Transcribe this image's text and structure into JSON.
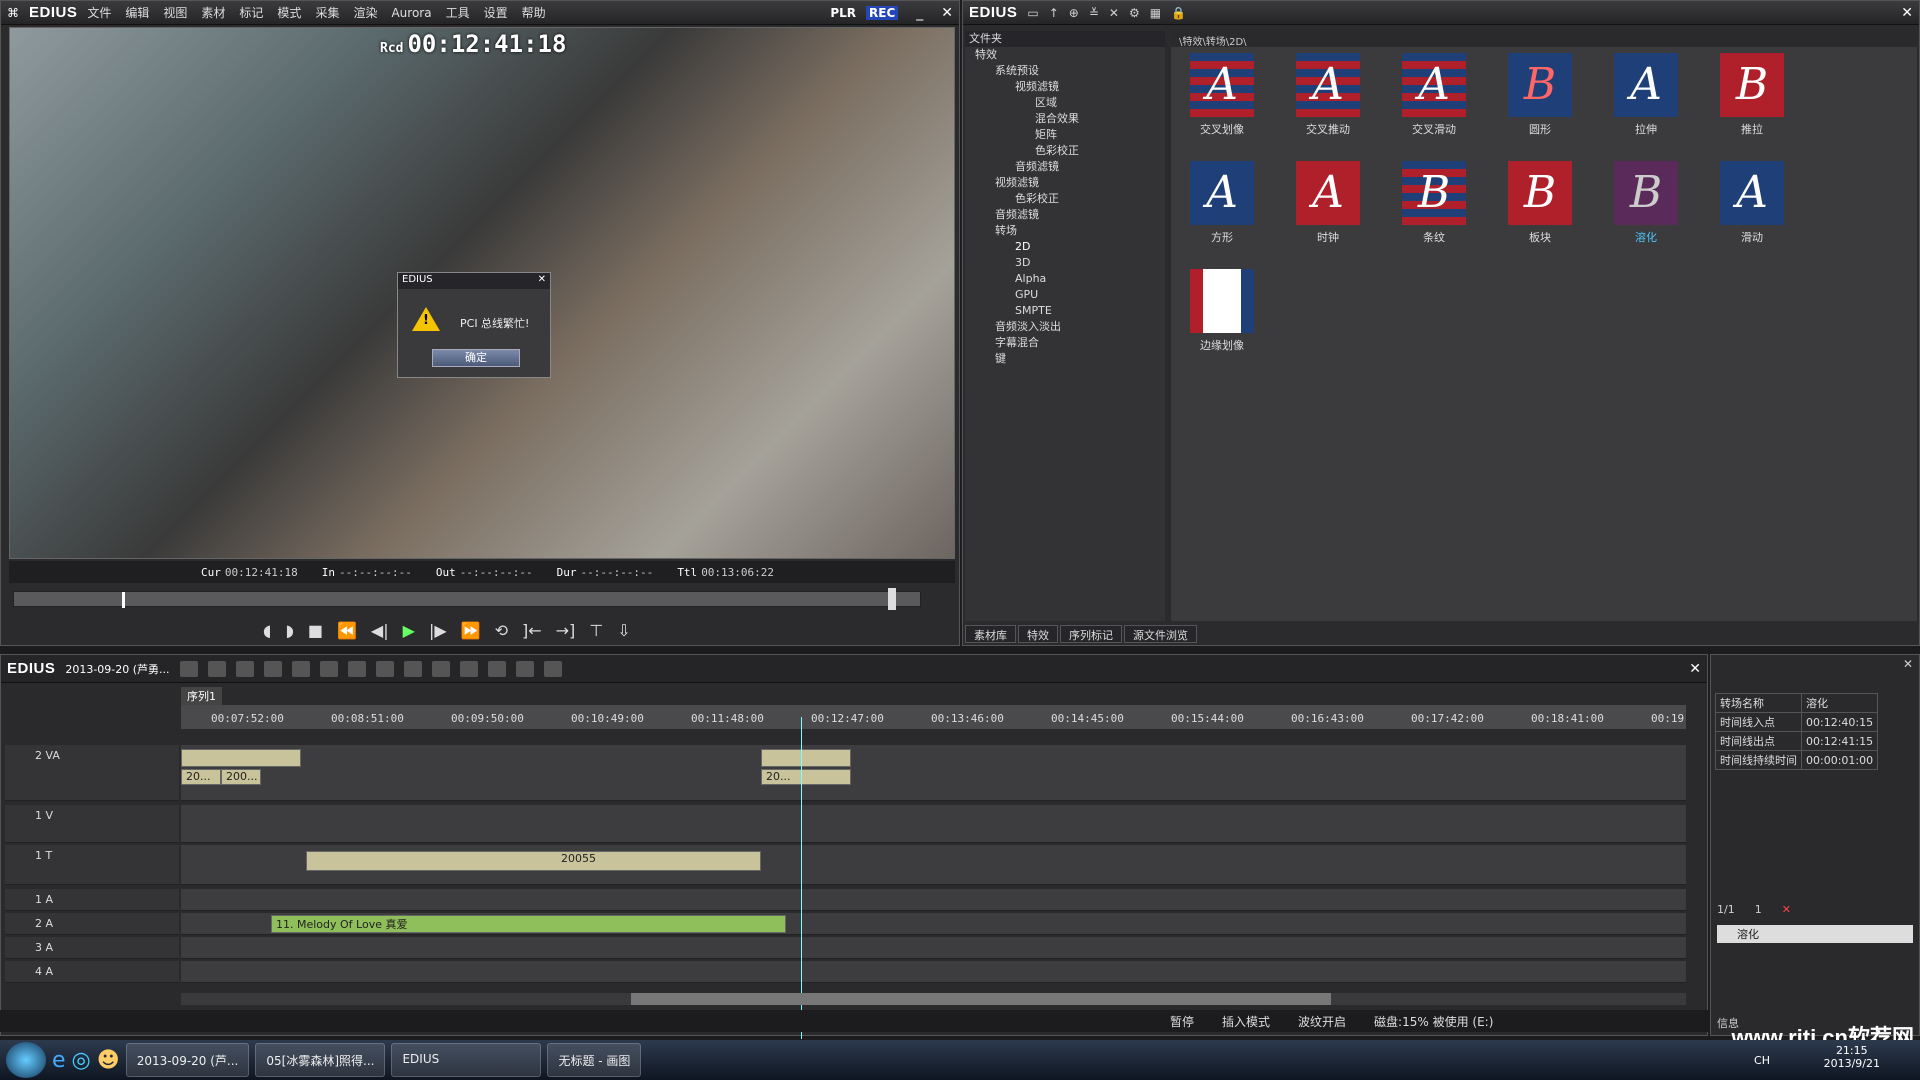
{
  "app": {
    "brand": "EDIUS",
    "menu": [
      "文件",
      "编辑",
      "视图",
      "素材",
      "标记",
      "模式",
      "采集",
      "渲染",
      "Aurora",
      "工具",
      "设置",
      "帮助"
    ],
    "plr": "PLR",
    "rec": "REC"
  },
  "player": {
    "rcd_label": "Rcd",
    "timecode": "00:12:41:18",
    "cur": "00:12:41:18",
    "in": "--:--:--:--",
    "out": "--:--:--:--",
    "dur": "--:--:--:--",
    "ttl": "00:13:06:22"
  },
  "dialog": {
    "title": "EDIUS",
    "message": "PCI 总线繁忙!",
    "ok": "确定"
  },
  "bin": {
    "brand": "EDIUS",
    "tree_header": "文件夹",
    "path": "\\特效\\转场\\2D\\",
    "tree": [
      "特效",
      "系统预设",
      "视频滤镜",
      "区域",
      "混合效果",
      "矩阵",
      "色彩校正",
      "音频滤镜",
      "视频滤镜",
      "色彩校正",
      "音频滤镜",
      "转场",
      "2D",
      "3D",
      "Alpha",
      "GPU",
      "SMPTE",
      "音频淡入淡出",
      "字幕混合",
      "键"
    ],
    "tiles": [
      "交叉划像",
      "交叉推动",
      "交叉滑动",
      "圆形",
      "拉伸",
      "推拉",
      "方形",
      "时钟",
      "条纹",
      "板块",
      "溶化",
      "滑动",
      "边缘划像"
    ],
    "tabs": [
      "素材库",
      "特效",
      "序列标记",
      "源文件浏览"
    ]
  },
  "timeline": {
    "brand": "EDIUS",
    "project": "2013-09-20 (芦勇...",
    "seq": "序列1",
    "ticks": [
      "00:07:52:00",
      "00:08:51:00",
      "00:09:50:00",
      "00:10:49:00",
      "00:11:48:00",
      "00:12:47:00",
      "00:13:46:00",
      "00:14:45:00",
      "00:15:44:00",
      "00:16:43:00",
      "00:17:42:00",
      "00:18:41:00",
      "00:19"
    ],
    "tracks": [
      "2 VA",
      "1 V",
      "1 T",
      "1 A",
      "2 A",
      "3 A",
      "4 A"
    ],
    "clip_a": "20...",
    "clip_b": "200...",
    "clip_c": "20...",
    "clip_d": "20055",
    "audio": "11. Melody Of Love 真爱"
  },
  "status": {
    "pause": "暂停",
    "insert": "插入模式",
    "ripple": "波纹开启",
    "disk": "磁盘:15% 被使用 (E:)"
  },
  "info": {
    "rows": [
      [
        "转场名称",
        "溶化"
      ],
      [
        "时间线入点",
        "00:12:40:15"
      ],
      [
        "时间线出点",
        "00:12:41:15"
      ],
      [
        "时间线持续时间",
        "00:00:01:00"
      ]
    ],
    "pager": "1/1",
    "count": "1",
    "item": "溶化",
    "footer": "信息"
  },
  "taskbar": {
    "items": [
      "2013-09-20 (芦...",
      "05[冰雾森林]照得...",
      "EDIUS",
      "无标题 - 画图"
    ],
    "time": "21:15",
    "date": "2013/9/21",
    "lang": "CH"
  },
  "watermark": "www.rjtj.cn软荐网"
}
